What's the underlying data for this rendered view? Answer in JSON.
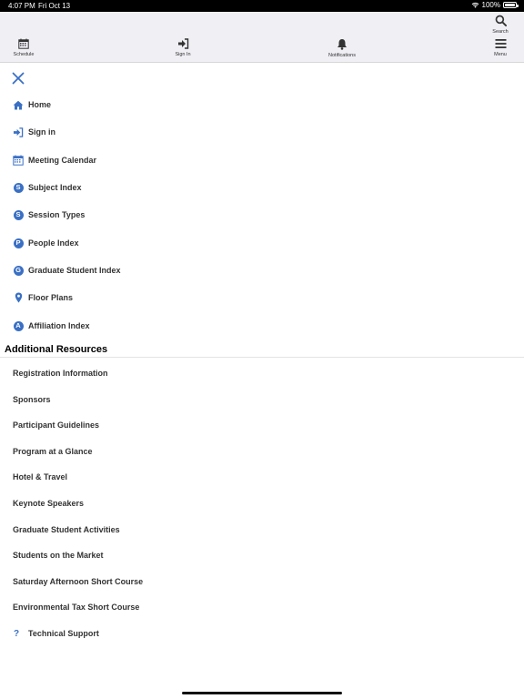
{
  "status_bar": {
    "time": "4:07 PM",
    "date": "Fri Oct 13",
    "battery": "100%"
  },
  "toolbar": {
    "search_label": "Search",
    "schedule_label": "Schedule",
    "signin_label": "Sign In",
    "notifications_label": "Notifications",
    "menu_label": "Menu"
  },
  "nav": {
    "items": [
      {
        "label": "Home",
        "icon": "home-icon"
      },
      {
        "label": "Sign in",
        "icon": "sign-in-icon"
      },
      {
        "label": "Meeting Calendar",
        "icon": "calendar-icon"
      },
      {
        "label": "Subject Index",
        "icon": "letter-s-circle-icon",
        "glyph": "S"
      },
      {
        "label": "Session Types",
        "icon": "letter-s-circle-icon",
        "glyph": "S"
      },
      {
        "label": "People Index",
        "icon": "letter-p-circle-icon",
        "glyph": "P"
      },
      {
        "label": "Graduate Student Index",
        "icon": "letter-g-circle-icon",
        "glyph": "G"
      },
      {
        "label": "Floor Plans",
        "icon": "map-pin-icon"
      },
      {
        "label": "Affiliation Index",
        "icon": "letter-a-circle-icon",
        "glyph": "A"
      }
    ]
  },
  "resources": {
    "title": "Additional Resources",
    "items": [
      {
        "label": "Registration Information"
      },
      {
        "label": "Sponsors"
      },
      {
        "label": "Participant Guidelines"
      },
      {
        "label": "Program at a Glance"
      },
      {
        "label": "Hotel & Travel"
      },
      {
        "label": "Keynote Speakers"
      },
      {
        "label": "Graduate Student Activities"
      },
      {
        "label": "Students on the Market"
      },
      {
        "label": "Saturday Afternoon Short Course"
      },
      {
        "label": "Environmental Tax Short Course"
      },
      {
        "label": "Technical Support",
        "icon": "question-icon",
        "glyph": "?"
      }
    ]
  },
  "colors": {
    "accent": "#3a70c4",
    "toolbar_bg": "#efeff4"
  }
}
